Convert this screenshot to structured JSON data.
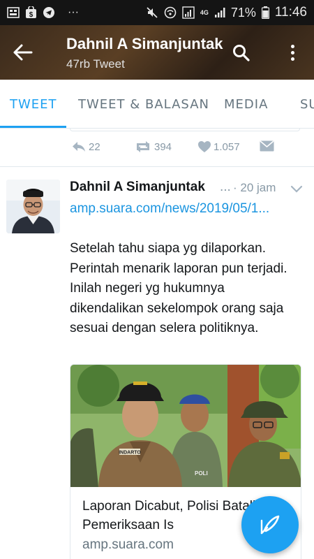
{
  "status_bar": {
    "battery_percent": "71%",
    "time": "11:46",
    "network": "4G",
    "icons": [
      "gallery-icon",
      "shopping-icon",
      "telegram-icon",
      "more-notifications-icon",
      "mute-icon",
      "wifi-calling-icon",
      "signal-icon",
      "battery-icon"
    ]
  },
  "header": {
    "title": "Dahnil A Simanjuntak",
    "subtitle": "47rb Tweet"
  },
  "tabs": [
    {
      "label": "TWEET",
      "active": true
    },
    {
      "label": "TWEET & BALASAN",
      "active": false
    },
    {
      "label": "MEDIA",
      "active": false
    },
    {
      "label": "SUKA",
      "active": false
    }
  ],
  "previous_tweet": {
    "reply_count": "22",
    "retweet_count": "394",
    "like_count": "1.057"
  },
  "tweet": {
    "author": "Dahnil A Simanjuntak",
    "ellipsis": "...",
    "time": "· 20 jam",
    "link": "amp.suara.com/news/2019/05/1...",
    "text": "Setelah tahu siapa yg dilaporkan. Perintah menarik laporan pun terjadi. Inilah negeri yg hukumnya dikendalikan sekelompok orang saja sesuai dengan selera politiknya.",
    "card": {
      "title": "Laporan Dicabut, Polisi Batalkan Pemeriksaan Is",
      "domain": "amp.suara.com",
      "name_tag": "INDARTO",
      "vest_text": "POLI"
    }
  },
  "colors": {
    "accent": "#1da1f2",
    "link": "#1b95e0",
    "muted": "#8899a6",
    "text": "#14171a"
  }
}
